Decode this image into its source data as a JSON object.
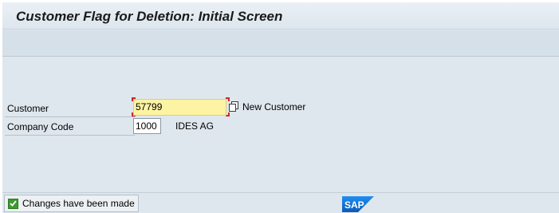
{
  "window": {
    "title": "Customer Flag for Deletion: Initial Screen"
  },
  "form": {
    "customer_label": "Customer",
    "customer_value": "57799",
    "new_customer_text": "New Customer",
    "company_code_label": "Company Code",
    "company_code_value": "1000",
    "company_name": "IDES AG"
  },
  "status_bar": {
    "message": "Changes have been made",
    "logo_text": "SAP"
  },
  "colors": {
    "accent": "#d2232a",
    "input_highlight": "#fcf3a3",
    "background": "#dfe7ee",
    "success": "#3c9a2c",
    "sap_blue": "#0a6ed1"
  },
  "icons": {
    "copy": "copy-icon",
    "status": "checkmark-icon",
    "logo": "sap-logo"
  }
}
